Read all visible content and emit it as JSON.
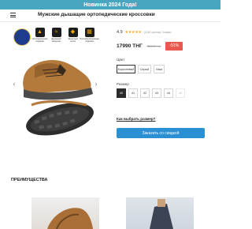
{
  "banner": {
    "text": "Новинка 2024 Года!"
  },
  "header": {
    "title": "Мужские дышащие ортопедические кроссовки"
  },
  "product": {
    "rating": "4.9",
    "stars": "★★★★★",
    "reviews": "(1245 оценок)  Отзывы",
    "price": "17990 ТНГ",
    "old_price": "35990 тнг",
    "discount": "-51%",
    "color_label": "Цвет",
    "colors": [
      "Коричневый",
      "Серый",
      "Хаки"
    ],
    "size_label": "Размер",
    "sizes": [
      "40",
      "41",
      "42",
      "43",
      "44",
      "45"
    ],
    "size_help": "Как выбрать размер?",
    "order_button": "Заказать со скидкой"
  },
  "gallery": {
    "features": [
      "Ортопедическая подошва",
      "Дышащий материал",
      "Защитный носок",
      "Противоскользящая подошва",
      "Лёгкий вес"
    ]
  },
  "sections": {
    "advantages_title": "ПРЕИМУЩЕСТВА"
  },
  "colors": {
    "banner": "#48a6c0",
    "accent_button": "#2a8fd3",
    "discount_badge": "#e85a4f",
    "stars": "#f5a623"
  }
}
